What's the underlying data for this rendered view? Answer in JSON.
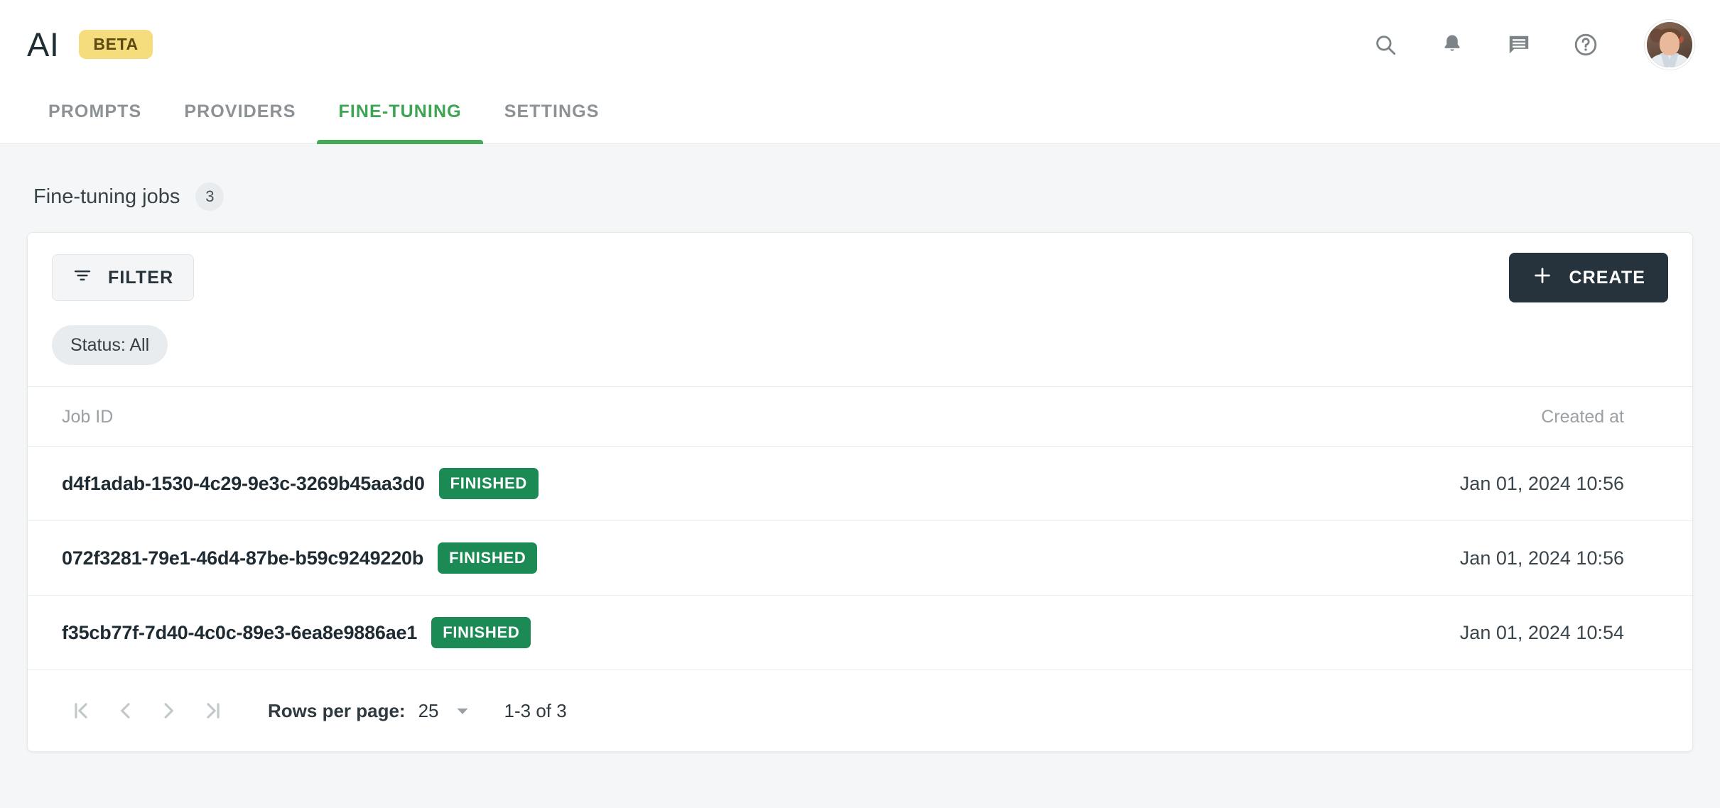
{
  "header": {
    "logo": "AI",
    "beta_label": "BETA",
    "icons": [
      "search-icon",
      "bell-icon",
      "chat-icon",
      "help-icon"
    ],
    "avatar_alt": "user-avatar"
  },
  "tabs": [
    {
      "label": "PROMPTS",
      "active": false
    },
    {
      "label": "PROVIDERS",
      "active": false
    },
    {
      "label": "FINE-TUNING",
      "active": true
    },
    {
      "label": "SETTINGS",
      "active": false
    }
  ],
  "page": {
    "title": "Fine-tuning jobs",
    "count": "3"
  },
  "toolbar": {
    "filter_label": "FILTER",
    "create_label": "CREATE",
    "plus_glyph": "+"
  },
  "filters": {
    "chips": [
      "Status: All"
    ]
  },
  "table": {
    "columns": [
      "Job ID",
      "Created at"
    ],
    "rows": [
      {
        "job_id": "d4f1adab-1530-4c29-9e3c-3269b45aa3d0",
        "status": "FINISHED",
        "created_at": "Jan 01, 2024 10:56"
      },
      {
        "job_id": "072f3281-79e1-46d4-87be-b59c9249220b",
        "status": "FINISHED",
        "created_at": "Jan 01, 2024 10:56"
      },
      {
        "job_id": "f35cb77f-7d40-4c0c-89e3-6ea8e9886ae1",
        "status": "FINISHED",
        "created_at": "Jan 01, 2024 10:54"
      }
    ]
  },
  "pagination": {
    "rows_per_page_label": "Rows per page:",
    "rows_per_page_value": "25",
    "range_label": "1-3 of 3"
  },
  "colors": {
    "accent_green": "#46a957",
    "status_green": "#1b8a54",
    "dark_button": "#26333d",
    "beta_yellow": "#f5dc7c",
    "page_background": "#f4f6f7"
  }
}
